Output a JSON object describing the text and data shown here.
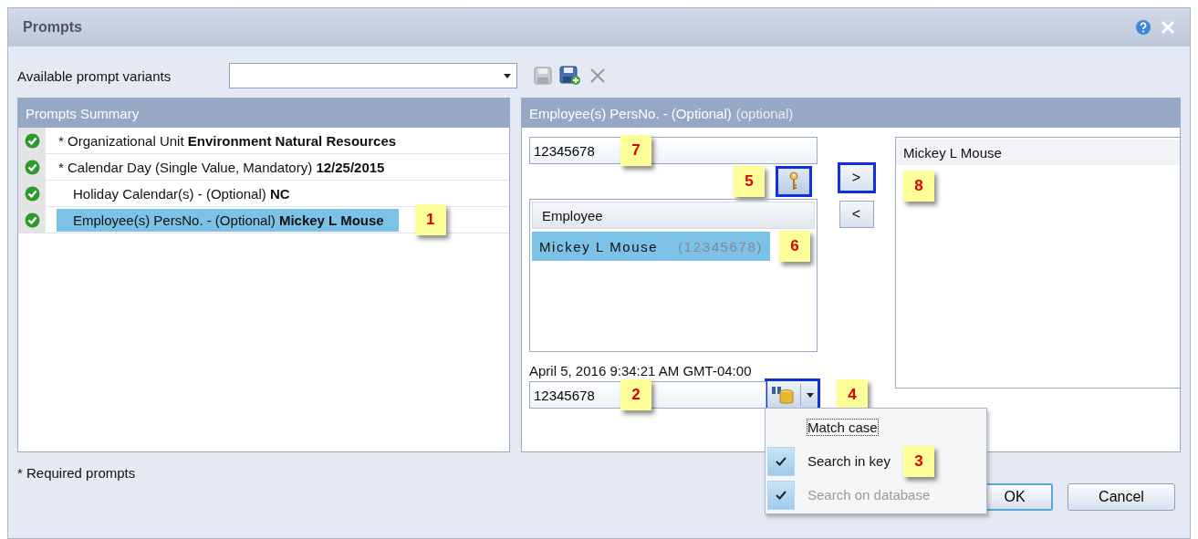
{
  "window": {
    "title": "Prompts"
  },
  "variants": {
    "label": "Available prompt variants"
  },
  "summary": {
    "title": "Prompts Summary",
    "items": [
      {
        "text": "* Organizational Unit **Environment Natural Resources**",
        "required": true,
        "selected": false
      },
      {
        "text": "* Calendar Day (Single Value, Mandatory) **12/25/2015**",
        "required": true,
        "selected": false
      },
      {
        "text": "Holiday Calendar(s) - (Optional) **NC**",
        "required": false,
        "selected": false
      },
      {
        "text": "Employee(s) PersNo. - (Optional) **Mickey L Mouse**",
        "required": false,
        "selected": true,
        "callout": "1"
      }
    ],
    "footnote": "* Required prompts"
  },
  "detail": {
    "title": "Employee(s) PersNo. - (Optional)",
    "subtitle": "(optional)",
    "key_field": {
      "value": "12345678",
      "callout": "7"
    },
    "key_button": {
      "highlighted": true,
      "callout": "5"
    },
    "list": {
      "header": "Employee",
      "rows": [
        {
          "name": "Mickey L Mouse",
          "key": "(12345678)",
          "selected": true,
          "callout": "6"
        }
      ]
    },
    "timestamp": "April 5, 2016 9:34:21 AM GMT-04:00",
    "search_field": {
      "value": "12345678",
      "callout": "2"
    },
    "search_button": {
      "highlighted": true,
      "callout": "4"
    },
    "search_menu": [
      {
        "label": "Match case",
        "checked": false,
        "disabled": false
      },
      {
        "label": "Search in key",
        "checked": true,
        "disabled": false,
        "callout": "3"
      },
      {
        "label": "Search on database",
        "checked": true,
        "disabled": true
      }
    ],
    "add_button": {
      "label": ">",
      "highlighted": true,
      "callout": "8"
    },
    "remove_button": {
      "label": "<",
      "highlighted": false
    },
    "selected_values": [
      "Mickey L Mouse"
    ]
  },
  "buttons": [
    "OK",
    "Cancel"
  ]
}
